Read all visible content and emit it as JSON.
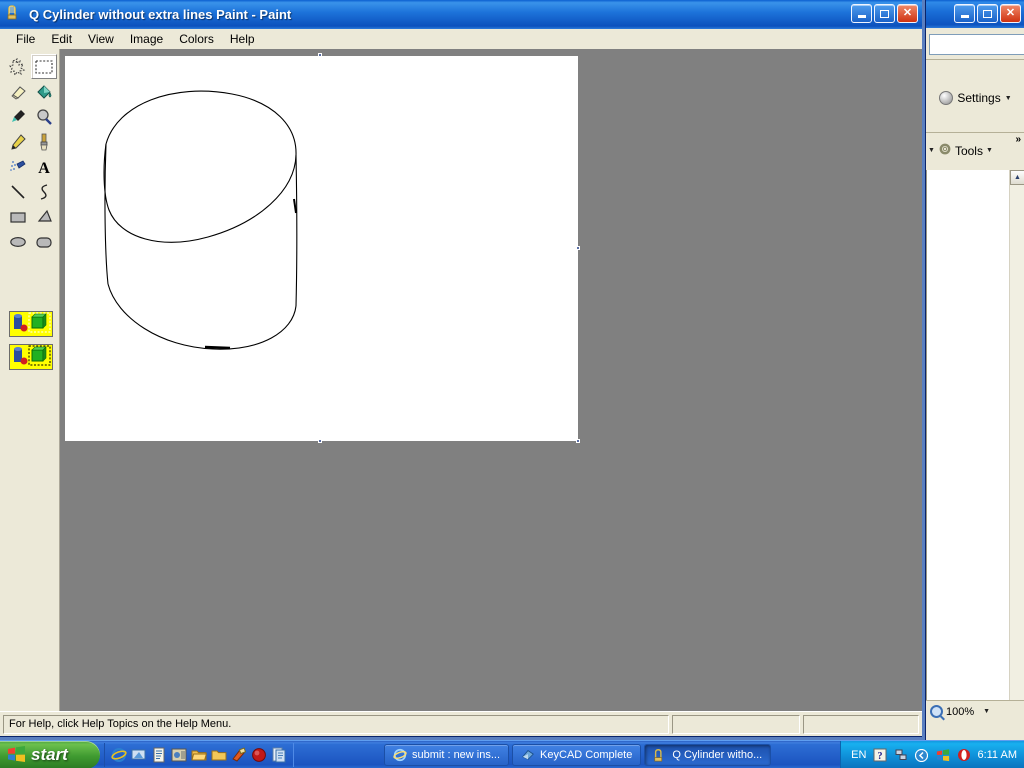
{
  "paint_window": {
    "title": "Q Cylinder without extra lines Paint - Paint",
    "icon": "paint-palette-icon",
    "window_buttons": {
      "minimize": "minimize-icon",
      "maximize": "maximize-icon",
      "close": "close-icon"
    },
    "menu": [
      {
        "label": "File"
      },
      {
        "label": "Edit"
      },
      {
        "label": "View"
      },
      {
        "label": "Image"
      },
      {
        "label": "Colors"
      },
      {
        "label": "Help"
      }
    ],
    "toolbox": {
      "tools": [
        {
          "name": "free-form-select",
          "label": "Free-Form Select",
          "selected": false
        },
        {
          "name": "rectangular-select",
          "label": "Select",
          "selected": true
        },
        {
          "name": "eraser",
          "label": "Eraser/Color Eraser",
          "selected": false
        },
        {
          "name": "fill-with-color",
          "label": "Fill With Color",
          "selected": false
        },
        {
          "name": "pick-color",
          "label": "Pick Color",
          "selected": false
        },
        {
          "name": "magnifier",
          "label": "Magnifier",
          "selected": false
        },
        {
          "name": "pencil",
          "label": "Pencil",
          "selected": false
        },
        {
          "name": "brush",
          "label": "Brush",
          "selected": false
        },
        {
          "name": "airbrush",
          "label": "Airbrush",
          "selected": false
        },
        {
          "name": "text",
          "label": "Text",
          "selected": false
        },
        {
          "name": "line",
          "label": "Line",
          "selected": false
        },
        {
          "name": "curve",
          "label": "Curve",
          "selected": false
        },
        {
          "name": "rectangle",
          "label": "Rectangle",
          "selected": false
        },
        {
          "name": "polygon",
          "label": "Polygon",
          "selected": false
        },
        {
          "name": "ellipse",
          "label": "Ellipse",
          "selected": false
        },
        {
          "name": "rounded-rectangle",
          "label": "Rounded Rectangle",
          "selected": false
        }
      ],
      "options": [
        {
          "name": "opaque-selection",
          "label": "Opaque background",
          "selected": true
        },
        {
          "name": "transparent-selection",
          "label": "Transparent background",
          "selected": false
        }
      ]
    },
    "canvas": {
      "drawing": "tilted-cylinder-line-drawing",
      "background": "#ffffff",
      "stroke": "#000000"
    },
    "statusbar": {
      "help_text": "For Help, click Help Topics on the Help Menu.",
      "pane2": "",
      "pane3": ""
    }
  },
  "background_window": {
    "search_value": "",
    "search_button": "search-icon",
    "search_dropdown": "chevron-down-icon",
    "settings_label": "Settings",
    "tools_label": "Tools",
    "chevrons_label": "»",
    "zoom_label": "100%",
    "window_buttons": {
      "minimize": "minimize-icon",
      "maximize": "maximize-icon",
      "close": "close-icon"
    }
  },
  "taskbar": {
    "start_label": "start",
    "quicklaunch": [
      {
        "name": "internet-explorer-icon"
      },
      {
        "name": "show-desktop-icon"
      },
      {
        "name": "notepad-icon"
      },
      {
        "name": "media-icon"
      },
      {
        "name": "folder-open-icon"
      },
      {
        "name": "folder-icon"
      },
      {
        "name": "paint-icon"
      },
      {
        "name": "record-icon"
      },
      {
        "name": "document-icon"
      }
    ],
    "buttons": [
      {
        "label": "submit : new ins...",
        "icon": "internet-explorer-icon",
        "active": false
      },
      {
        "label": "KeyCAD Complete",
        "icon": "keycad-icon",
        "active": false
      },
      {
        "label": "Q Cylinder witho...",
        "icon": "paint-palette-icon",
        "active": true
      }
    ],
    "tray": {
      "language": "EN",
      "icons": [
        {
          "name": "help-question-icon"
        },
        {
          "name": "network-icon"
        },
        {
          "name": "chevron-left-icon"
        },
        {
          "name": "windows-security-icon"
        },
        {
          "name": "opera-icon"
        }
      ],
      "time": "6:11 AM"
    }
  }
}
